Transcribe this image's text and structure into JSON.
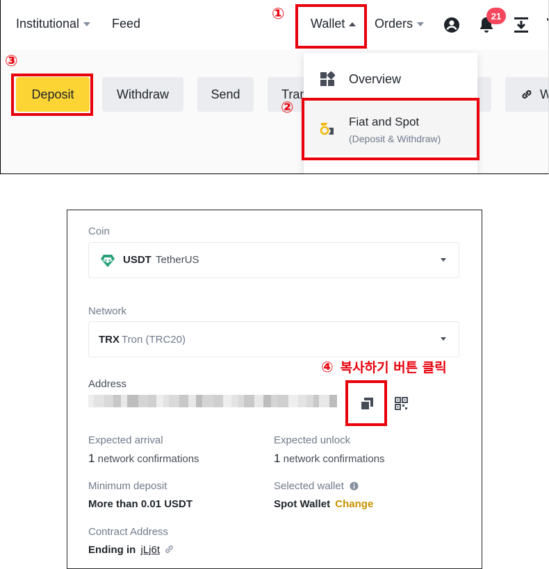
{
  "nav": {
    "institutional": "Institutional",
    "feed": "Feed",
    "wallet": "Wallet",
    "orders": "Orders",
    "notification_count": "21"
  },
  "actions": {
    "deposit": "Deposit",
    "withdraw": "Withdraw",
    "send": "Send",
    "transfer_partial": "Tran",
    "partial_w": "W"
  },
  "wallet_menu": {
    "overview": "Overview",
    "fiat_spot_title": "Fiat and Spot",
    "fiat_spot_sub": "(Deposit & Withdraw)"
  },
  "annotations": {
    "step1": "①",
    "step2": "②",
    "step3": "③",
    "step4": "④",
    "step4_text": "복사하기 버튼 클릭"
  },
  "deposit_form": {
    "coin_label": "Coin",
    "coin_symbol": "USDT",
    "coin_name": "TetherUS",
    "network_label": "Network",
    "network_symbol": "TRX",
    "network_name": "Tron (TRC20)",
    "address_label": "Address",
    "expected_arrival_label": "Expected arrival",
    "expected_arrival_num": "1",
    "expected_arrival_text": "network confirmations",
    "expected_unlock_label": "Expected unlock",
    "expected_unlock_num": "1",
    "expected_unlock_text": "network confirmations",
    "min_deposit_label": "Minimum deposit",
    "min_deposit_value": "More than 0.01 USDT",
    "selected_wallet_label": "Selected wallet",
    "selected_wallet_value": "Spot Wallet",
    "change_link": "Change",
    "contract_label": "Contract Address",
    "contract_prefix": "Ending in",
    "contract_suffix": "jLj6t"
  },
  "colors": {
    "brand_yellow": "#fcd535",
    "annotation_red": "#e8000b",
    "badge_red": "#f6465d",
    "tether_green": "#26a17b",
    "link_gold": "#c99400"
  },
  "icons": [
    "chevron-down-icon",
    "chevron-up-icon",
    "user-icon",
    "bell-icon",
    "download-icon",
    "grid-icon",
    "coin-icon",
    "link-icon",
    "tether-icon",
    "copy-icon",
    "qr-code-icon",
    "info-icon"
  ]
}
